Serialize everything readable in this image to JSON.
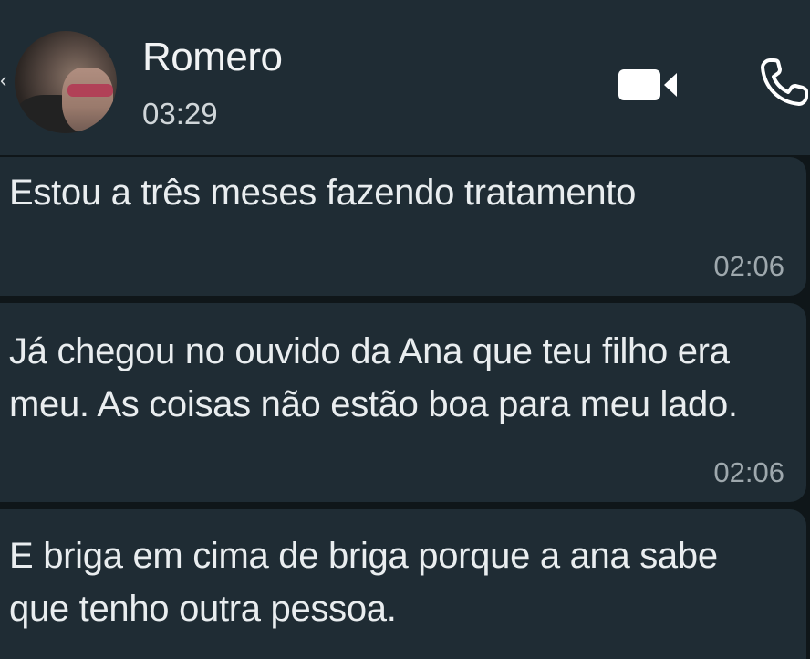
{
  "header": {
    "contact_name": "Romero",
    "status": "03:29",
    "icons": [
      "back-arrow-icon",
      "video-call-icon",
      "voice-call-icon"
    ]
  },
  "messages": [
    {
      "text": "Estou a três meses fazendo tratamento",
      "time": "02:06"
    },
    {
      "text": "Já chegou no ouvido da Ana que teu filho era meu. As coisas não estão boa para meu lado.",
      "time": "02:06"
    },
    {
      "text": "E briga em cima de briga porque a ana sabe que tenho outra pessoa.",
      "time": ""
    }
  ],
  "colors": {
    "background": "#0f1619",
    "bubble": "#1f2c34",
    "text": "#e9edef",
    "timestamp": "#9ea8ad"
  }
}
